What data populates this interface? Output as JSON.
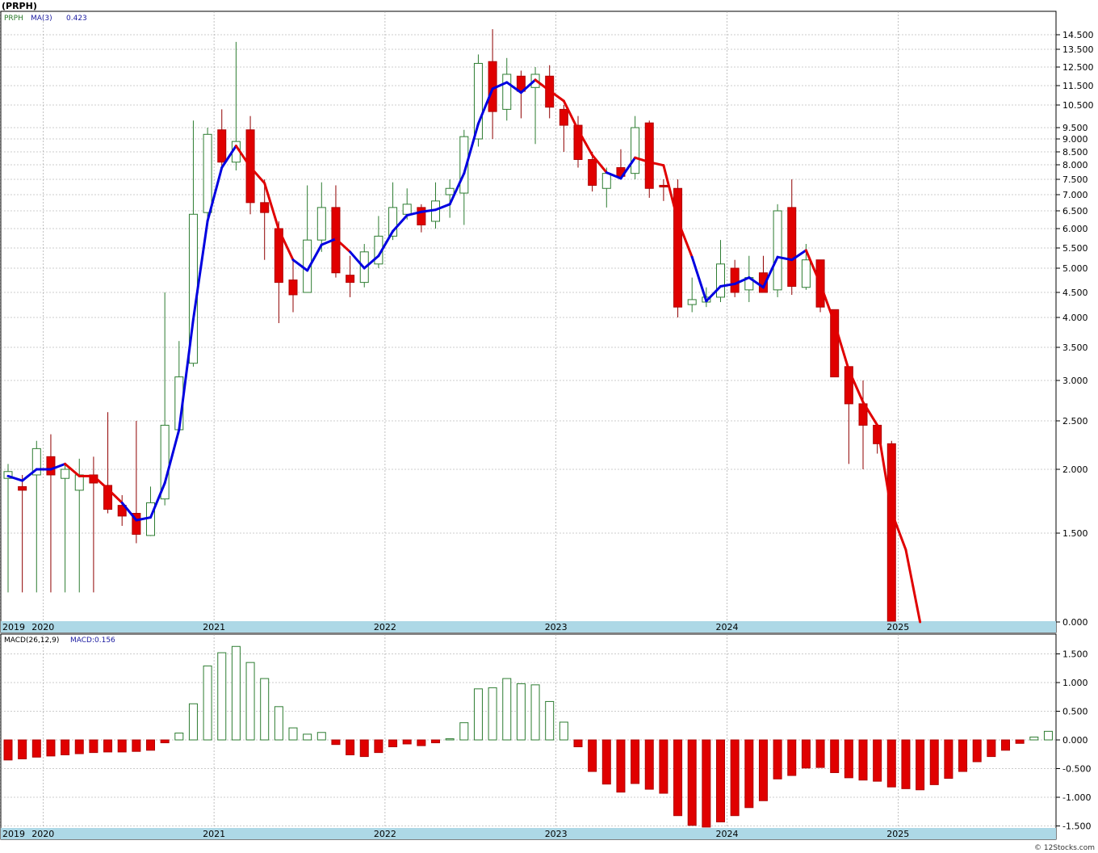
{
  "title": "(PRPH)",
  "footer": "© 12Stocks.com",
  "colors": {
    "up": "#2e7d32",
    "down": "#e00000",
    "ma_up": "#0000e0",
    "ma_down": "#e00000",
    "axis_band": "#add8e6",
    "grid": "#999999",
    "label_green": "#2a7a2a",
    "label_blue": "#1a1aa0"
  },
  "chart_data": [
    {
      "type": "candlestick",
      "name": "price",
      "legend": {
        "symbol": "PRPH",
        "ma_label": "MA(3)",
        "ma_value": "0.423"
      },
      "scale": "log",
      "y_ticks": [
        14.5,
        13.5,
        12.5,
        11.5,
        10.5,
        9.5,
        9.0,
        8.5,
        8.0,
        7.5,
        7.0,
        6.5,
        6.0,
        5.5,
        5.0,
        4.5,
        4.0,
        3.5,
        3.0,
        2.5,
        2.0,
        1.5,
        0.0
      ],
      "y_tick_labels": [
        "14.500",
        "13.500",
        "12.500",
        "11.500",
        "10.500",
        "9.500",
        "9.000",
        "8.500",
        "8.000",
        "7.500",
        "7.000",
        "6.500",
        "6.000",
        "5.500",
        "5.000",
        "4.500",
        "4.000",
        "3.500",
        "3.000",
        "2.500",
        "2.000",
        "1.500",
        "0.000"
      ],
      "x_labels": [
        "2019",
        "2020",
        "2021",
        "2022",
        "2023",
        "2024",
        "2025"
      ],
      "x_label_months": [
        -1,
        2,
        14,
        26,
        38,
        50,
        62
      ],
      "candles": [
        {
          "o": 1.92,
          "h": 2.05,
          "l": 0.5,
          "c": 1.98
        },
        {
          "o": 1.85,
          "h": 1.95,
          "l": 0.5,
          "c": 1.82
        },
        {
          "o": 1.95,
          "h": 2.28,
          "l": 0.5,
          "c": 2.2
        },
        {
          "o": 2.12,
          "h": 2.35,
          "l": 0.5,
          "c": 1.95
        },
        {
          "o": 1.92,
          "h": 2.05,
          "l": 0.5,
          "c": 2.0
        },
        {
          "o": 1.82,
          "h": 2.1,
          "l": 0.5,
          "c": 1.95
        },
        {
          "o": 1.95,
          "h": 2.12,
          "l": 0.5,
          "c": 1.88
        },
        {
          "o": 1.86,
          "h": 2.6,
          "l": 1.64,
          "c": 1.67
        },
        {
          "o": 1.7,
          "h": 1.78,
          "l": 1.55,
          "c": 1.62
        },
        {
          "o": 1.64,
          "h": 2.5,
          "l": 1.33,
          "c": 1.48
        },
        {
          "o": 1.46,
          "h": 1.85,
          "l": 1.45,
          "c": 1.72
        },
        {
          "o": 1.75,
          "h": 4.5,
          "l": 1.7,
          "c": 2.45
        },
        {
          "o": 2.4,
          "h": 3.6,
          "l": 2.36,
          "c": 3.05
        },
        {
          "o": 3.25,
          "h": 9.8,
          "l": 3.2,
          "c": 6.4
        },
        {
          "o": 6.45,
          "h": 9.5,
          "l": 6.3,
          "c": 9.2
        },
        {
          "o": 9.4,
          "h": 10.3,
          "l": 7.9,
          "c": 8.1
        },
        {
          "o": 8.1,
          "h": 14.0,
          "l": 7.8,
          "c": 8.9
        },
        {
          "o": 9.4,
          "h": 10.0,
          "l": 6.4,
          "c": 6.75
        },
        {
          "o": 6.75,
          "h": 7.5,
          "l": 5.2,
          "c": 6.45
        },
        {
          "o": 6.0,
          "h": 6.2,
          "l": 3.9,
          "c": 4.7
        },
        {
          "o": 4.75,
          "h": 5.2,
          "l": 4.1,
          "c": 4.45
        },
        {
          "o": 4.5,
          "h": 7.3,
          "l": 4.5,
          "c": 5.7
        },
        {
          "o": 5.7,
          "h": 7.4,
          "l": 5.4,
          "c": 6.6
        },
        {
          "o": 6.6,
          "h": 7.3,
          "l": 4.8,
          "c": 4.9
        },
        {
          "o": 4.85,
          "h": 5.3,
          "l": 4.4,
          "c": 4.7
        },
        {
          "o": 4.7,
          "h": 5.6,
          "l": 4.6,
          "c": 5.4
        },
        {
          "o": 5.1,
          "h": 6.35,
          "l": 5.0,
          "c": 5.8
        },
        {
          "o": 5.8,
          "h": 7.4,
          "l": 5.7,
          "c": 6.6
        },
        {
          "o": 6.4,
          "h": 7.2,
          "l": 6.25,
          "c": 6.7
        },
        {
          "o": 6.6,
          "h": 6.7,
          "l": 5.9,
          "c": 6.1
        },
        {
          "o": 6.2,
          "h": 7.4,
          "l": 6.0,
          "c": 6.8
        },
        {
          "o": 7.0,
          "h": 7.5,
          "l": 6.3,
          "c": 7.2
        },
        {
          "o": 7.05,
          "h": 9.4,
          "l": 6.1,
          "c": 9.1
        },
        {
          "o": 9.0,
          "h": 13.2,
          "l": 8.7,
          "c": 12.7
        },
        {
          "o": 12.8,
          "h": 14.9,
          "l": 9.0,
          "c": 10.2
        },
        {
          "o": 10.3,
          "h": 13.0,
          "l": 9.8,
          "c": 12.1
        },
        {
          "o": 12.0,
          "h": 12.3,
          "l": 9.9,
          "c": 11.2
        },
        {
          "o": 11.4,
          "h": 12.5,
          "l": 8.8,
          "c": 12.1
        },
        {
          "o": 12.0,
          "h": 12.6,
          "l": 9.9,
          "c": 10.4
        },
        {
          "o": 10.3,
          "h": 10.5,
          "l": 8.5,
          "c": 9.6
        },
        {
          "o": 9.6,
          "h": 10.0,
          "l": 7.9,
          "c": 8.2
        },
        {
          "o": 8.2,
          "h": 8.5,
          "l": 7.1,
          "c": 7.3
        },
        {
          "o": 7.2,
          "h": 7.9,
          "l": 6.6,
          "c": 7.7
        },
        {
          "o": 7.9,
          "h": 8.6,
          "l": 7.5,
          "c": 7.6
        },
        {
          "o": 7.7,
          "h": 10.0,
          "l": 7.5,
          "c": 9.5
        },
        {
          "o": 9.7,
          "h": 9.8,
          "l": 6.9,
          "c": 7.2
        },
        {
          "o": 7.3,
          "h": 7.5,
          "l": 6.8,
          "c": 7.25
        },
        {
          "o": 7.2,
          "h": 7.5,
          "l": 4.0,
          "c": 4.2
        },
        {
          "o": 4.25,
          "h": 4.8,
          "l": 4.1,
          "c": 4.35
        },
        {
          "o": 4.3,
          "h": 4.6,
          "l": 4.2,
          "c": 4.4
        },
        {
          "o": 4.4,
          "h": 5.7,
          "l": 4.3,
          "c": 5.1
        },
        {
          "o": 5.0,
          "h": 5.2,
          "l": 4.4,
          "c": 4.5
        },
        {
          "o": 4.55,
          "h": 5.3,
          "l": 4.3,
          "c": 4.8
        },
        {
          "o": 4.9,
          "h": 5.3,
          "l": 4.5,
          "c": 4.5
        },
        {
          "o": 4.55,
          "h": 6.7,
          "l": 4.4,
          "c": 6.5
        },
        {
          "o": 6.6,
          "h": 7.5,
          "l": 4.45,
          "c": 4.62
        },
        {
          "o": 4.6,
          "h": 5.6,
          "l": 4.55,
          "c": 5.2
        },
        {
          "o": 5.2,
          "h": 5.2,
          "l": 4.1,
          "c": 4.2
        },
        {
          "o": 4.15,
          "h": 4.15,
          "l": 3.05,
          "c": 3.05
        },
        {
          "o": 3.2,
          "h": 3.2,
          "l": 2.05,
          "c": 2.7
        },
        {
          "o": 2.7,
          "h": 3.0,
          "l": 2.0,
          "c": 2.45
        },
        {
          "o": 2.45,
          "h": 2.45,
          "l": 2.15,
          "c": 2.25
        },
        {
          "o": 2.25,
          "h": 2.28,
          "l": 0.0,
          "c": 0.0
        }
      ],
      "ma3": [
        1.94,
        1.9,
        2.0,
        2.0,
        2.05,
        1.94,
        1.94,
        1.83,
        1.72,
        1.59,
        1.61,
        1.88,
        2.4,
        3.97,
        6.21,
        7.9,
        8.73,
        7.92,
        7.37,
        5.97,
        5.2,
        4.95,
        5.58,
        5.73,
        5.4,
        5.0,
        5.3,
        5.93,
        6.37,
        6.47,
        6.53,
        6.7,
        7.7,
        9.67,
        11.33,
        11.67,
        11.13,
        11.8,
        11.23,
        10.7,
        9.4,
        8.37,
        7.73,
        7.53,
        8.27,
        8.1,
        7.98,
        6.22,
        5.27,
        4.32,
        4.62,
        4.67,
        4.8,
        4.6,
        5.27,
        5.2,
        5.44,
        4.67,
        3.9,
        3.15,
        2.72,
        2.45,
        1.65,
        1.22,
        0.0
      ],
      "ma3_dir": [
        -1,
        1,
        1,
        1,
        1,
        -1,
        -1,
        -1,
        -1,
        1,
        1,
        1,
        1,
        1,
        1,
        1,
        1,
        -1,
        -1,
        -1,
        -1,
        1,
        1,
        1,
        -1,
        1,
        1,
        1,
        1,
        1,
        1,
        1,
        1,
        1,
        1,
        1,
        1,
        1,
        -1,
        -1,
        -1,
        -1,
        -1,
        1,
        1,
        -1,
        -1,
        -1,
        -1,
        1,
        1,
        1,
        1,
        1,
        1,
        1,
        1,
        -1,
        -1,
        -1,
        -1,
        -1,
        -1,
        -1,
        -1
      ]
    },
    {
      "type": "bar",
      "name": "macd",
      "legend": {
        "label": "MACD(26,12,9)",
        "value_label": "MACD:0.156"
      },
      "y_ticks": [
        1.5,
        1.0,
        0.5,
        0.0,
        -0.5,
        -1.0,
        -1.5
      ],
      "y_tick_labels": [
        "1.500",
        "1.000",
        "0.500",
        "0.000",
        "-0.500",
        "-1.000",
        "-1.500"
      ],
      "x_labels": [
        "2019",
        "2020",
        "2021",
        "2022",
        "2023",
        "2024",
        "2025"
      ],
      "x_label_months": [
        -1,
        2,
        14,
        26,
        38,
        50,
        62
      ],
      "values": [
        -0.35,
        -0.33,
        -0.3,
        -0.28,
        -0.26,
        -0.24,
        -0.22,
        -0.21,
        -0.21,
        -0.2,
        -0.18,
        -0.05,
        0.12,
        0.63,
        1.29,
        1.52,
        1.63,
        1.35,
        1.07,
        0.58,
        0.21,
        0.1,
        0.13,
        -0.08,
        -0.26,
        -0.29,
        -0.22,
        -0.12,
        -0.07,
        -0.1,
        -0.05,
        0.02,
        0.3,
        0.89,
        0.91,
        1.07,
        0.98,
        0.96,
        0.67,
        0.31,
        -0.12,
        -0.55,
        -0.77,
        -0.91,
        -0.76,
        -0.86,
        -0.93,
        -1.32,
        -1.49,
        -1.52,
        -1.43,
        -1.32,
        -1.18,
        -1.06,
        -0.68,
        -0.62,
        -0.49,
        -0.48,
        -0.57,
        -0.66,
        -0.7,
        -0.72,
        -0.82,
        -0.85,
        -0.87,
        -0.78,
        -0.67,
        -0.55,
        -0.38,
        -0.29,
        -0.18,
        -0.06,
        0.05,
        0.15
      ]
    }
  ]
}
